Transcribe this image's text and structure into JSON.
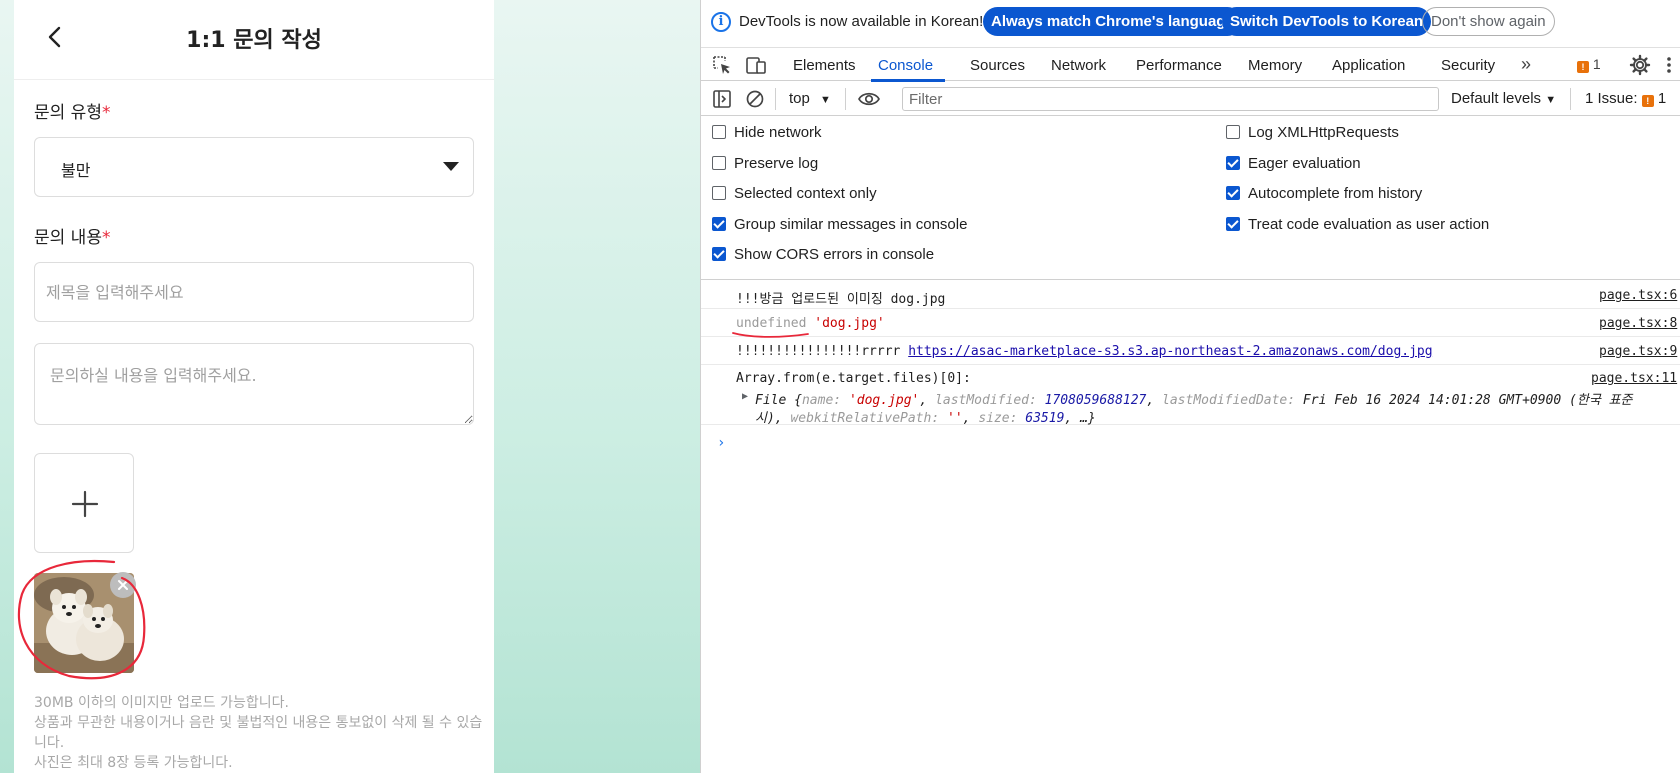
{
  "app": {
    "title": "1:1 문의 작성",
    "inquiry_type": {
      "label": "문의 유형",
      "required_mark": "*",
      "selected": "불만"
    },
    "inquiry_content": {
      "label": "문의 내용",
      "required_mark": "*",
      "title_placeholder": "제목을 입력해주세요",
      "body_placeholder": "문의하실 내용을 입력해주세요."
    },
    "upload": {
      "add_icon": "plus-icon",
      "thumbnail_alt": "dog.jpg"
    },
    "notice": {
      "line1": "30MB 이하의 이미지만 업로드 가능합니다.",
      "line2": "상품과 무관한 내용이거나 음란 및 불법적인 내용은 통보없이 삭제 될 수 있습니다.",
      "line3": "사진은 최대 8장 등록 가능합니다."
    }
  },
  "devtools": {
    "infobar": {
      "message": "DevTools is now available in Korean!",
      "btn_match": "Always match Chrome's language",
      "btn_switch": "Switch DevTools to Korean",
      "btn_dismiss": "Don't show again"
    },
    "tabs": [
      {
        "label": "Elements"
      },
      {
        "label": "Console"
      },
      {
        "label": "Sources"
      },
      {
        "label": "Network"
      },
      {
        "label": "Performance"
      },
      {
        "label": "Memory"
      },
      {
        "label": "Application"
      },
      {
        "label": "Security"
      }
    ],
    "more_tabs": "»",
    "issues_badge_count": "1",
    "toolbar": {
      "context": "top",
      "filter_placeholder": "Filter",
      "levels": "Default levels",
      "issues_label": "1 Issue:",
      "issues_count": "1"
    },
    "settings": {
      "left": [
        {
          "label": "Hide network",
          "checked": false
        },
        {
          "label": "Preserve log",
          "checked": false
        },
        {
          "label": "Selected context only",
          "checked": false
        },
        {
          "label": "Group similar messages in console",
          "checked": true
        },
        {
          "label": "Show CORS errors in console",
          "checked": true
        }
      ],
      "right": [
        {
          "label": "Log XMLHttpRequests",
          "checked": false
        },
        {
          "label": "Eager evaluation",
          "checked": true
        },
        {
          "label": "Autocomplete from history",
          "checked": true
        },
        {
          "label": "Treat code evaluation as user action",
          "checked": true
        }
      ]
    },
    "console": {
      "msg1_text": "!!!방금 업로드된 이미징 dog.jpg",
      "msg1_src": "page.tsx:6",
      "msg2_undefined": "undefined",
      "msg2_str": "'dog.jpg'",
      "msg2_src": "page.tsx:8",
      "msg3_prefix": "!!!!!!!!!!!!!!!!rrrrr",
      "msg3_url": "https://asac-marketplace-s3.s3.ap-northeast-2.amazonaws.com/dog.jpg",
      "msg3_src": "page.tsx:9",
      "msg4_head": "Array.from(e.target.files)[0]:",
      "msg4_src": "page.tsx:11",
      "file_obj": {
        "type": "File",
        "name_key": "name:",
        "name_val": "'dog.jpg'",
        "lm_key": "lastModified:",
        "lm_val": "1708059688127",
        "lmd_key": "lastModifiedDate:",
        "lmd_val": "Fri Feb 16 2024 14:01:28 GMT+0900 (한국 표준",
        "line2_a": "시),",
        "wrp_key": "webkitRelativePath:",
        "wrp_val": "''",
        "size_key": "size:",
        "size_val": "63519",
        "rest": ", …}"
      },
      "prompt": "›"
    },
    "colors": {
      "accent": "#0b57d0",
      "error_string": "#c80000",
      "number": "#1a1aa6",
      "annotation": "#e8283a"
    }
  }
}
